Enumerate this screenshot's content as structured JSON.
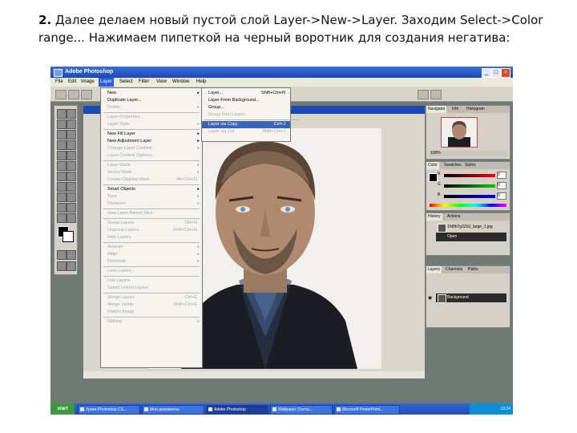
{
  "caption": {
    "number": "2.",
    "text": "Далее делаем новый пустой слой Layer->New->Layer. Заходим Select->Color range... Нажимаем пипеткой на черный воротник для создания негатива:"
  },
  "app": {
    "title": "Adobe Photoshop"
  },
  "menubar": [
    "File",
    "Edit",
    "Image",
    "Layer",
    "Select",
    "Filter",
    "View",
    "Window",
    "Help"
  ],
  "layer_menu": [
    {
      "label": "New",
      "arrow": true
    },
    {
      "label": "Duplicate Layer..."
    },
    {
      "label": "Delete",
      "disabled": true,
      "arrow": true
    },
    {
      "sep": true
    },
    {
      "label": "Layer Properties...",
      "disabled": true
    },
    {
      "label": "Layer Style",
      "disabled": true,
      "arrow": true
    },
    {
      "sep": true
    },
    {
      "label": "New Fill Layer",
      "arrow": true
    },
    {
      "label": "New Adjustment Layer",
      "arrow": true
    },
    {
      "label": "Change Layer Content",
      "disabled": true,
      "arrow": true
    },
    {
      "label": "Layer Content Options...",
      "disabled": true
    },
    {
      "sep": true
    },
    {
      "label": "Layer Mask",
      "disabled": true,
      "arrow": true
    },
    {
      "label": "Vector Mask",
      "disabled": true,
      "arrow": true
    },
    {
      "label": "Create Clipping Mask",
      "disabled": true,
      "shortcut": "Alt+Ctrl+G"
    },
    {
      "sep": true
    },
    {
      "label": "Smart Objects",
      "arrow": true
    },
    {
      "label": "Type",
      "disabled": true,
      "arrow": true
    },
    {
      "label": "Rasterize",
      "disabled": true,
      "arrow": true
    },
    {
      "sep": true
    },
    {
      "label": "New Layer Based Slice",
      "disabled": true
    },
    {
      "sep": true
    },
    {
      "label": "Group Layers",
      "disabled": true,
      "shortcut": "Ctrl+G"
    },
    {
      "label": "Ungroup Layers",
      "disabled": true,
      "shortcut": "Shift+Ctrl+G"
    },
    {
      "label": "Hide Layers",
      "disabled": true
    },
    {
      "sep": true
    },
    {
      "label": "Arrange",
      "disabled": true,
      "arrow": true
    },
    {
      "label": "Align",
      "disabled": true,
      "arrow": true
    },
    {
      "label": "Distribute",
      "disabled": true,
      "arrow": true
    },
    {
      "sep": true
    },
    {
      "label": "Lock Layers...",
      "disabled": true
    },
    {
      "sep": true
    },
    {
      "label": "Link Layers",
      "disabled": true
    },
    {
      "label": "Select Linked Layers",
      "disabled": true
    },
    {
      "sep": true
    },
    {
      "label": "Merge Layers",
      "disabled": true,
      "shortcut": "Ctrl+E"
    },
    {
      "label": "Merge Visible",
      "disabled": true,
      "shortcut": "Shift+Ctrl+E"
    },
    {
      "label": "Flatten Image",
      "disabled": true
    },
    {
      "sep": true
    },
    {
      "label": "Matting",
      "disabled": true,
      "arrow": true
    }
  ],
  "new_submenu": [
    {
      "label": "Layer...",
      "shortcut": "Shift+Ctrl+N"
    },
    {
      "label": "Layer From Background..."
    },
    {
      "label": "Group..."
    },
    {
      "label": "Group from Layers...",
      "disabled": true
    },
    {
      "sep": true
    },
    {
      "label": "Layer via Copy",
      "shortcut": "Ctrl+J",
      "highlighted": true
    },
    {
      "label": "Layer via Cut",
      "shortcut": "Shift+Ctrl+J",
      "disabled": true
    }
  ],
  "panels": {
    "navigator": {
      "tabs": [
        "Navigator",
        "Info",
        "Histogram"
      ],
      "zoom": "100%"
    },
    "color": {
      "tabs": [
        "Color",
        "Swatches",
        "Styles"
      ],
      "channels": [
        "R",
        "G",
        "B"
      ],
      "values": [
        "0",
        "0",
        "0"
      ]
    },
    "history": {
      "tabs": [
        "History",
        "Actions"
      ],
      "items": [
        "1h8fb7g2ZdJ_large_1.jpg",
        "Open"
      ]
    },
    "layers": {
      "tabs": [
        "Layers",
        "Channels",
        "Paths"
      ],
      "items": [
        "Background"
      ]
    }
  },
  "taskbar": {
    "start": "start",
    "tasks": [
      "Уроки Photoshop CS...",
      "Мои документы",
      "Adobe Photoshop",
      "Wallpaper (Тесты...",
      "Microsoft PowerPoint..."
    ],
    "clock": "13:34"
  }
}
